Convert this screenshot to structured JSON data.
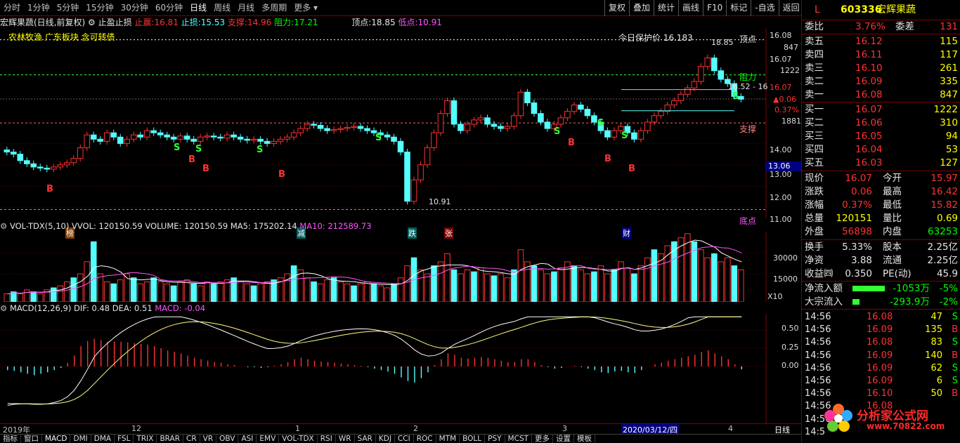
{
  "toolbar": {
    "tabs": [
      "分时",
      "1分钟",
      "5分钟",
      "15分钟",
      "30分钟",
      "60分钟",
      "日线",
      "周线",
      "月线",
      "多周期",
      "更多"
    ],
    "right": [
      "复权",
      "叠加",
      "统计",
      "画线",
      "F10",
      "标记",
      "-自选",
      "返回"
    ]
  },
  "info": {
    "name": "宏辉果蔬(日线,前复权)",
    "indicator": "止盈止损",
    "zhiying_label": "止赢:",
    "zhiying": "16.81",
    "zhisun_label": "止损:",
    "zhisun": "15.53",
    "support_label": "支撑:",
    "support": "14.96",
    "resist_label": "阻力:",
    "resist": "17.21",
    "top_label": "顶点:",
    "top": "18.85",
    "bottom_label": "低点:",
    "bottom": "10.91"
  },
  "sector": "农林牧渔 广东板块 含可转债",
  "chart_labels": {
    "protect": "今日保护价 16.183",
    "top_mark": "18.85",
    "top_text": "顶点",
    "resist_text": "阻力",
    "support_text": "支撑",
    "bottom_text": "底点",
    "low_mark": "10.91",
    "range_text": "16.52 - 16"
  },
  "price_axis": [
    "16.08",
    "847",
    "16.07",
    "1222",
    "16.07",
    "▲0.06",
    "0.37%",
    "1881",
    "14.00",
    "13.00",
    "12.00",
    "11.00"
  ],
  "price_highlight": "13.06",
  "event_tags": [
    "榜",
    "减",
    "跌",
    "张",
    "财"
  ],
  "volume": {
    "header_name": "VOL-TDX(5,10)",
    "header_rest": "VVOL: 120150.59  VOLUME: 120150.59  MA5: 175202.14",
    "header_ma10": "MA10: 212589.73",
    "axis": [
      "30000",
      "15000"
    ],
    "unit": "X10"
  },
  "macd": {
    "header_name": "MACD(12,26,9)",
    "header_rest": "DIF: 0.48  DEA: 0.51",
    "header_macd": "MACD: -0.04",
    "axis": [
      "0.50",
      "0.25",
      "0.00"
    ]
  },
  "time_axis": [
    "2019年",
    "12",
    "1",
    "2",
    "3",
    "2020/03/12/四",
    "4",
    "日线"
  ],
  "bottom_tabs": [
    "指标",
    "窗口",
    "MACD",
    "DMI",
    "DMA",
    "FSL",
    "TRIX",
    "BRAR",
    "CR",
    "VR",
    "OBV",
    "ASI",
    "EMV",
    "VOL-TDX",
    "RSI",
    "WR",
    "SAR",
    "KDJ",
    "CCI",
    "ROC",
    "MTM",
    "BOLL",
    "PSY",
    "MCST",
    "更多",
    "设置",
    "模板"
  ],
  "quote": {
    "flag": "L",
    "code": "603336",
    "name": "宏辉果蔬",
    "weibi_label": "委比",
    "weibi": "3.76%",
    "weicha_label": "委差",
    "weicha": "131",
    "asks": [
      [
        "卖五",
        "16.12",
        "115"
      ],
      [
        "卖四",
        "16.11",
        "117"
      ],
      [
        "卖三",
        "16.10",
        "261"
      ],
      [
        "卖二",
        "16.09",
        "335"
      ],
      [
        "卖一",
        "16.08",
        "847"
      ]
    ],
    "bids": [
      [
        "买一",
        "16.07",
        "1222"
      ],
      [
        "买二",
        "16.06",
        "310"
      ],
      [
        "买三",
        "16.05",
        "94"
      ],
      [
        "买四",
        "16.04",
        "53"
      ],
      [
        "买五",
        "16.03",
        "127"
      ]
    ],
    "stats": [
      [
        "现价",
        "16.07",
        "今开",
        "15.97"
      ],
      [
        "涨跌",
        "0.06",
        "最高",
        "16.42"
      ],
      [
        "涨幅",
        "0.37%",
        "最低",
        "15.82"
      ],
      [
        "总量",
        "120151",
        "量比",
        "0.69"
      ],
      [
        "外盘",
        "56898",
        "内盘",
        "63253"
      ]
    ],
    "stats2": [
      [
        "换手",
        "5.33%",
        "股本",
        "2.25亿"
      ],
      [
        "净资",
        "3.88",
        "流通",
        "2.25亿"
      ],
      [
        "收益㈣",
        "0.350",
        "PE(动)",
        "45.9"
      ]
    ],
    "flow": [
      [
        "净流入额",
        "-1053万",
        "-5%"
      ],
      [
        "大宗流入",
        "-293.9万",
        "-2%"
      ]
    ],
    "ticks": [
      [
        "14:56",
        "16.08",
        "47",
        "S"
      ],
      [
        "14:56",
        "16.09",
        "135",
        "B"
      ],
      [
        "14:56",
        "16.08",
        "83",
        "S"
      ],
      [
        "14:56",
        "16.09",
        "140",
        "B"
      ],
      [
        "14:56",
        "16.09",
        "62",
        "S"
      ],
      [
        "14:56",
        "16.09",
        "6",
        "S"
      ],
      [
        "14:56",
        "16.10",
        "50",
        "B"
      ],
      [
        "14:56",
        "16.08",
        "",
        ""
      ],
      [
        "14:56",
        "",
        "",
        " "
      ],
      [
        "14:5",
        "",
        "",
        ""
      ]
    ]
  },
  "watermark": {
    "text": "分析家公式网",
    "url": "www.70822.com"
  }
}
